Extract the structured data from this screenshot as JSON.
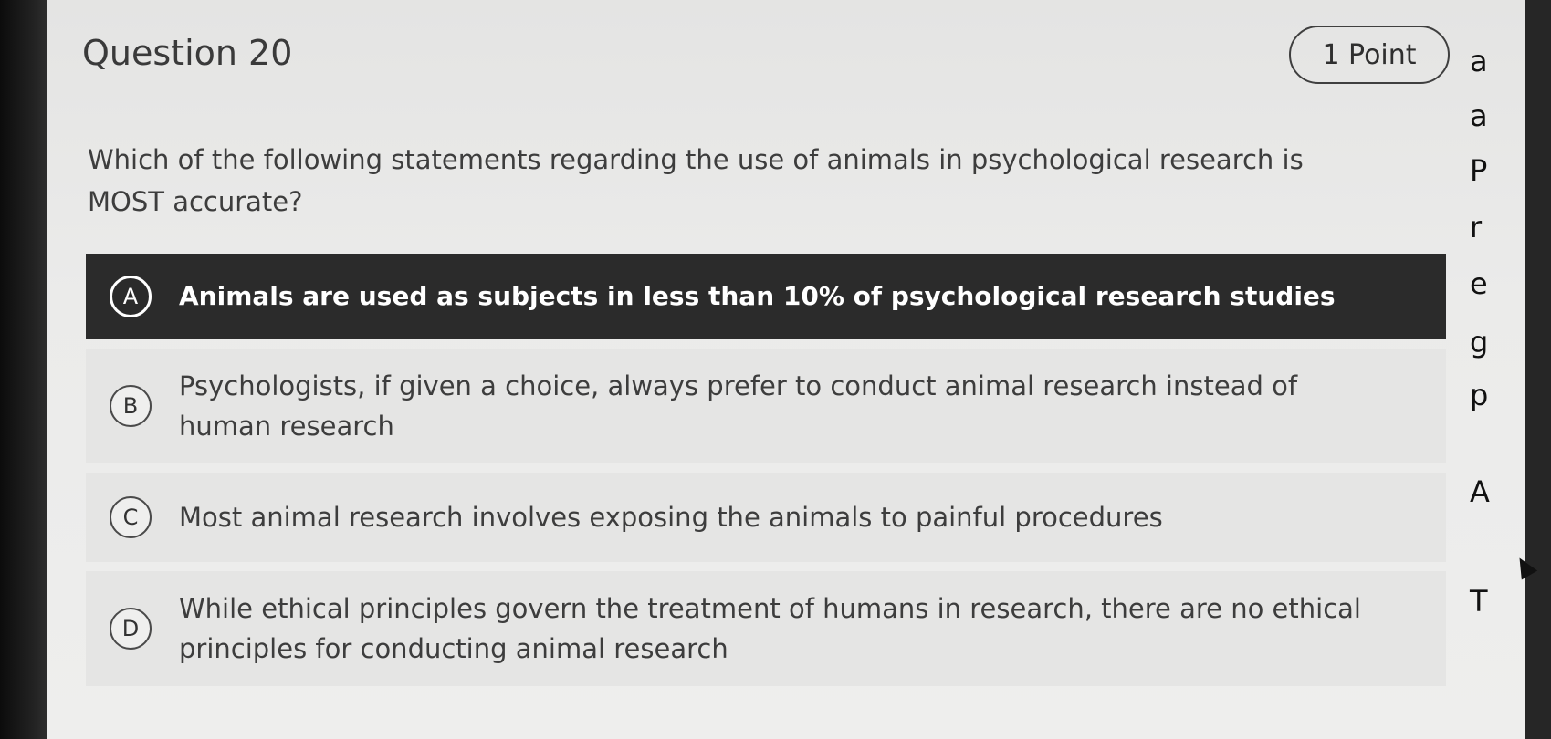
{
  "question": {
    "title": "Question 20",
    "points": "1 Point",
    "text": "Which of the following statements regarding the use of animals in psychological research is MOST accurate?"
  },
  "options": [
    {
      "letter": "A",
      "text": "Animals are used as subjects in less than 10% of psychological research studies",
      "selected": true
    },
    {
      "letter": "B",
      "text": "Psychologists, if given a choice, always prefer to conduct animal research instead of human research",
      "selected": false
    },
    {
      "letter": "C",
      "text": "Most animal research involves exposing the animals to painful procedures",
      "selected": false
    },
    {
      "letter": "D",
      "text": "While ethical principles govern the treatment of humans in research, there are no ethical principles for conducting animal research",
      "selected": false
    }
  ],
  "side_panel": {
    "glyphs": [
      "a",
      "a",
      "P",
      "r",
      "e",
      "g",
      "p",
      "A",
      "T"
    ]
  },
  "colors": {
    "selected_bg": "#2b2b2b",
    "option_bg": "#e5e5e4",
    "text": "#3d3d3d"
  }
}
